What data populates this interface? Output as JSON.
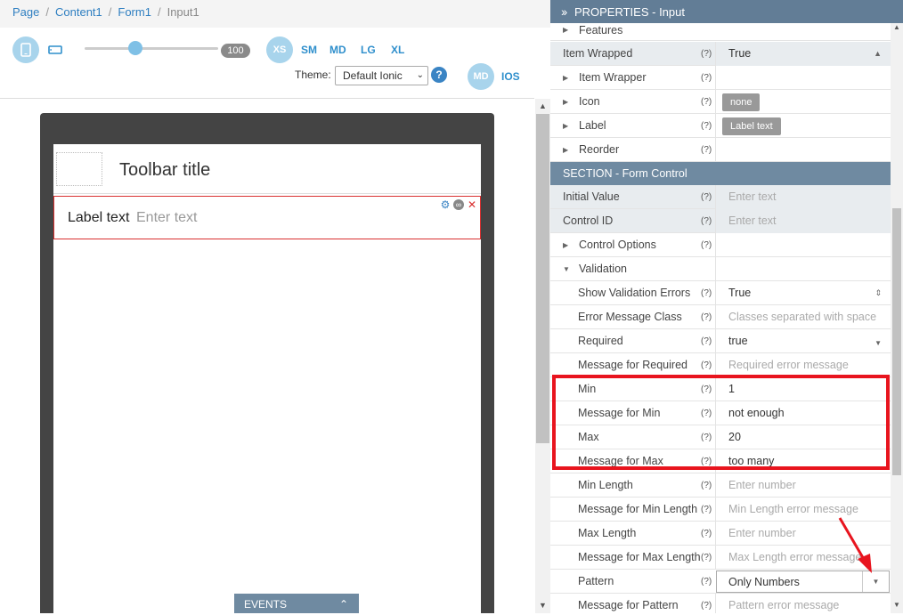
{
  "breadcrumb": {
    "items": [
      "Page",
      "Content1",
      "Form1"
    ],
    "current": "Input1",
    "separator": "/"
  },
  "toolbar": {
    "device_phone_icon": "phone-icon",
    "device_tablet_icon": "tablet-landscape-icon",
    "zoom": "100",
    "breakpoints": [
      "XS",
      "SM",
      "MD",
      "LG",
      "XL"
    ],
    "theme_label": "Theme:",
    "theme_value": "Default Ionic",
    "help": "?",
    "mode_md": "MD",
    "mode_ios": "IOS"
  },
  "preview": {
    "toolbar_title": "Toolbar title",
    "item_label": "Label text",
    "item_placeholder": "Enter text",
    "events_tab": "EVENTS"
  },
  "properties": {
    "header": "PROPERTIES - Input",
    "help_marker": "(?)",
    "rows_top": [
      {
        "name": "Features",
        "value": ""
      },
      {
        "name": "Item Wrapped",
        "value": "True"
      },
      {
        "name": "Item Wrapper",
        "value": ""
      },
      {
        "name": "Icon",
        "value": "none"
      },
      {
        "name": "Label",
        "value": "Label text"
      },
      {
        "name": "Reorder",
        "value": ""
      }
    ],
    "section_form_control": "SECTION - Form Control",
    "rows_form": [
      {
        "name": "Initial Value",
        "value": "Enter text"
      },
      {
        "name": "Control ID",
        "value": "Enter text"
      },
      {
        "name": "Control Options",
        "value": ""
      },
      {
        "name": "Validation",
        "value": ""
      },
      {
        "name": "Show Validation Errors",
        "value": "True"
      },
      {
        "name": "Error Message Class",
        "value": "Classes separated with space"
      },
      {
        "name": "Required",
        "value": "true"
      },
      {
        "name": "Message for Required",
        "value": "Required error message"
      },
      {
        "name": "Min",
        "value": "1"
      },
      {
        "name": "Message for Min",
        "value": "not enough"
      },
      {
        "name": "Max",
        "value": "20"
      },
      {
        "name": "Message for Max",
        "value": "too many"
      },
      {
        "name": "Min Length",
        "value": "Enter number"
      },
      {
        "name": "Message for Min Length",
        "value": "Min Length error message"
      },
      {
        "name": "Max Length",
        "value": "Enter number"
      },
      {
        "name": "Message for Max Length",
        "value": "Max Length error message"
      },
      {
        "name": "Pattern",
        "value": "Only Numbers"
      },
      {
        "name": "Message for Pattern",
        "value": "Pattern error message"
      }
    ]
  },
  "colors": {
    "accent": "#2f7fc1",
    "header_bg": "#627d96",
    "section_bg": "#6f8aa1",
    "highlight": "#e8141e"
  }
}
